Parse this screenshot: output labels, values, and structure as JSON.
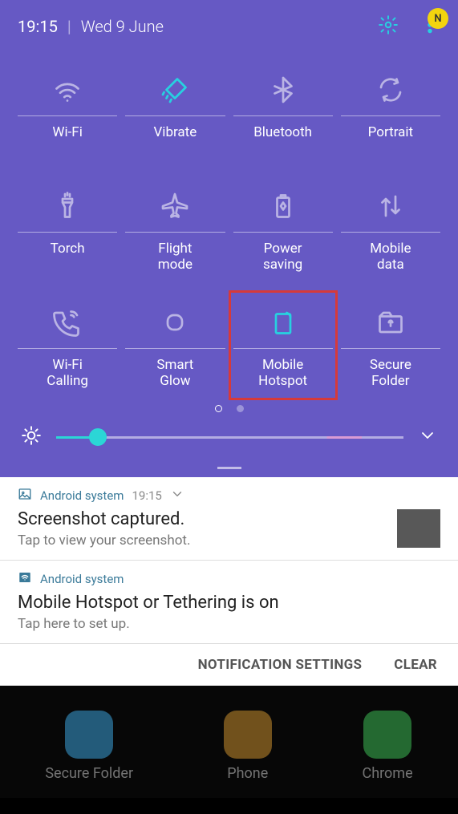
{
  "status": {
    "time": "19:15",
    "date": "Wed 9 June",
    "avatar_letter": "N"
  },
  "tiles": [
    {
      "id": "wifi",
      "label": "Wi-Fi",
      "icon": "wifi-icon",
      "dim": true
    },
    {
      "id": "vibrate",
      "label": "Vibrate",
      "icon": "vibrate-icon",
      "active": true
    },
    {
      "id": "bluetooth",
      "label": "Bluetooth",
      "icon": "bluetooth-icon",
      "dim": true
    },
    {
      "id": "portrait",
      "label": "Portrait",
      "icon": "rotate-icon",
      "dim": true
    },
    {
      "id": "torch",
      "label": "Torch",
      "icon": "torch-icon",
      "dim": true
    },
    {
      "id": "flight",
      "label": "Flight mode",
      "icon": "airplane-icon",
      "dim": true
    },
    {
      "id": "power",
      "label": "Power saving",
      "icon": "battery-icon",
      "dim": true
    },
    {
      "id": "mobiledata",
      "label": "Mobile data",
      "icon": "data-arrows-icon",
      "dim": true
    },
    {
      "id": "wificalling",
      "label": "Wi-Fi Calling",
      "icon": "wifi-calling-icon",
      "dim": true
    },
    {
      "id": "smartglow",
      "label": "Smart Glow",
      "icon": "smartglow-icon",
      "dim": true
    },
    {
      "id": "hotspot",
      "label": "Mobile Hotspot",
      "icon": "hotspot-icon",
      "active": true,
      "highlight": true
    },
    {
      "id": "securefolder",
      "label": "Secure Folder",
      "icon": "secure-folder-icon",
      "dim": true
    }
  ],
  "brightness": {
    "value_pct": 12
  },
  "notifications": [
    {
      "app": "Android system",
      "time": "19:15",
      "title": "Screenshot captured.",
      "subtitle": "Tap to view your screenshot.",
      "icon": "picture-icon",
      "has_thumb": true,
      "has_chevron": true
    },
    {
      "app": "Android system",
      "title": "Mobile Hotspot or Tethering is on",
      "subtitle": "Tap here to set up.",
      "icon": "wifi-small-icon"
    }
  ],
  "actions": {
    "settings": "NOTIFICATION SETTINGS",
    "clear": "CLEAR"
  },
  "home_apps": [
    {
      "label": "Secure Folder",
      "color": "#3aa0d8"
    },
    {
      "label": "Phone",
      "color": "#c98f2e"
    },
    {
      "label": "Chrome",
      "color": "#3cba54"
    }
  ]
}
